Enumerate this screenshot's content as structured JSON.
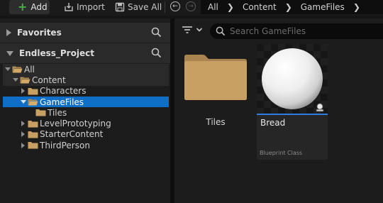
{
  "toolbar": {
    "add_label": "Add",
    "import_label": "Import",
    "save_all_label": "Save All"
  },
  "breadcrumb": [
    "All",
    "Content",
    "GameFiles"
  ],
  "favorites": {
    "title": "Favorites"
  },
  "project": {
    "title": "Endless_Project"
  },
  "tree": [
    {
      "label": "All",
      "expanded": true
    },
    {
      "label": "Content",
      "expanded": true
    },
    {
      "label": "Characters",
      "expanded": false
    },
    {
      "label": "GameFiles",
      "expanded": true,
      "selected": true
    },
    {
      "label": "Tiles"
    },
    {
      "label": "LevelPrototyping",
      "expanded": false
    },
    {
      "label": "StarterContent",
      "expanded": false
    },
    {
      "label": "ThirdPerson",
      "expanded": false
    }
  ],
  "search": {
    "placeholder": "Search GameFiles"
  },
  "content": {
    "folders": [
      {
        "label": "Tiles"
      }
    ],
    "assets": [
      {
        "name": "Bread",
        "type": "Blueprint Class"
      }
    ]
  },
  "colors": {
    "selection": "#0f6fc6",
    "folder": "#c8a062",
    "add_plus": "#45b04a",
    "asset_bar": "#2e7de0"
  }
}
